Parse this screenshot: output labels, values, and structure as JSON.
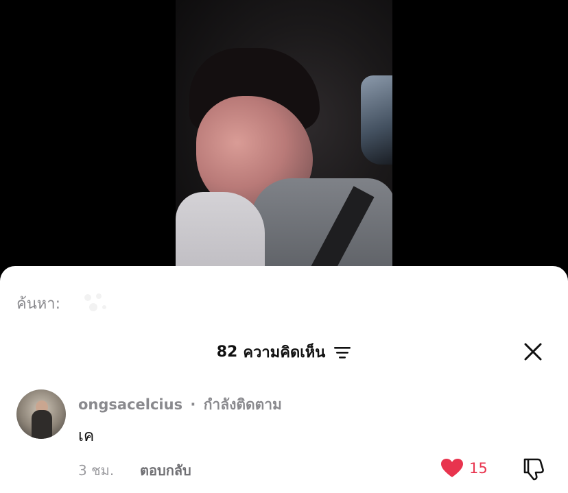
{
  "search": {
    "label": "ค้นหา:"
  },
  "comments_header": {
    "count": "82",
    "title": "ความคิดเห็น"
  },
  "comment": {
    "username": "ongsacelcius",
    "separator": "·",
    "follow_status": "กำลังติดตาม",
    "text": "เค",
    "time": "3 ชม.",
    "reply_label": "ตอบกลับ",
    "like_count": "15"
  },
  "colors": {
    "like_accent": "#e8344e",
    "secondary_text": "#8a8a8e"
  },
  "icons": {
    "filter": "sort-lines-icon",
    "close": "close-x-icon",
    "like": "heart-icon",
    "dislike": "thumbs-down-icon"
  }
}
